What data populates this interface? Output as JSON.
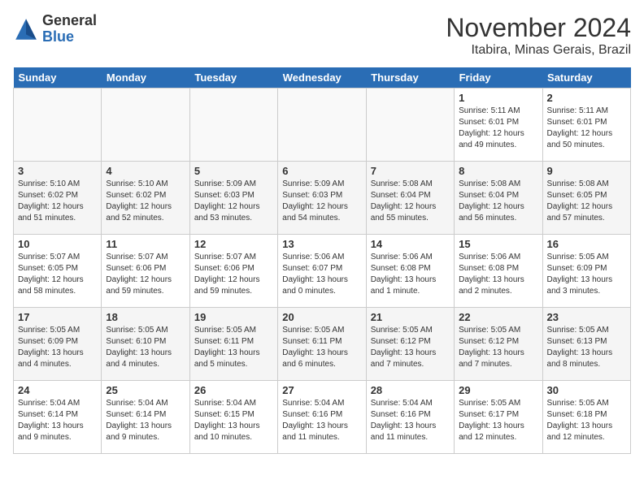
{
  "header": {
    "logo_general": "General",
    "logo_blue": "Blue",
    "month_title": "November 2024",
    "location": "Itabira, Minas Gerais, Brazil"
  },
  "days_of_week": [
    "Sunday",
    "Monday",
    "Tuesday",
    "Wednesday",
    "Thursday",
    "Friday",
    "Saturday"
  ],
  "weeks": [
    [
      {
        "day": "",
        "detail": ""
      },
      {
        "day": "",
        "detail": ""
      },
      {
        "day": "",
        "detail": ""
      },
      {
        "day": "",
        "detail": ""
      },
      {
        "day": "",
        "detail": ""
      },
      {
        "day": "1",
        "detail": "Sunrise: 5:11 AM\nSunset: 6:01 PM\nDaylight: 12 hours\nand 49 minutes."
      },
      {
        "day": "2",
        "detail": "Sunrise: 5:11 AM\nSunset: 6:01 PM\nDaylight: 12 hours\nand 50 minutes."
      }
    ],
    [
      {
        "day": "3",
        "detail": "Sunrise: 5:10 AM\nSunset: 6:02 PM\nDaylight: 12 hours\nand 51 minutes."
      },
      {
        "day": "4",
        "detail": "Sunrise: 5:10 AM\nSunset: 6:02 PM\nDaylight: 12 hours\nand 52 minutes."
      },
      {
        "day": "5",
        "detail": "Sunrise: 5:09 AM\nSunset: 6:03 PM\nDaylight: 12 hours\nand 53 minutes."
      },
      {
        "day": "6",
        "detail": "Sunrise: 5:09 AM\nSunset: 6:03 PM\nDaylight: 12 hours\nand 54 minutes."
      },
      {
        "day": "7",
        "detail": "Sunrise: 5:08 AM\nSunset: 6:04 PM\nDaylight: 12 hours\nand 55 minutes."
      },
      {
        "day": "8",
        "detail": "Sunrise: 5:08 AM\nSunset: 6:04 PM\nDaylight: 12 hours\nand 56 minutes."
      },
      {
        "day": "9",
        "detail": "Sunrise: 5:08 AM\nSunset: 6:05 PM\nDaylight: 12 hours\nand 57 minutes."
      }
    ],
    [
      {
        "day": "10",
        "detail": "Sunrise: 5:07 AM\nSunset: 6:05 PM\nDaylight: 12 hours\nand 58 minutes."
      },
      {
        "day": "11",
        "detail": "Sunrise: 5:07 AM\nSunset: 6:06 PM\nDaylight: 12 hours\nand 59 minutes."
      },
      {
        "day": "12",
        "detail": "Sunrise: 5:07 AM\nSunset: 6:06 PM\nDaylight: 12 hours\nand 59 minutes."
      },
      {
        "day": "13",
        "detail": "Sunrise: 5:06 AM\nSunset: 6:07 PM\nDaylight: 13 hours\nand 0 minutes."
      },
      {
        "day": "14",
        "detail": "Sunrise: 5:06 AM\nSunset: 6:08 PM\nDaylight: 13 hours\nand 1 minute."
      },
      {
        "day": "15",
        "detail": "Sunrise: 5:06 AM\nSunset: 6:08 PM\nDaylight: 13 hours\nand 2 minutes."
      },
      {
        "day": "16",
        "detail": "Sunrise: 5:05 AM\nSunset: 6:09 PM\nDaylight: 13 hours\nand 3 minutes."
      }
    ],
    [
      {
        "day": "17",
        "detail": "Sunrise: 5:05 AM\nSunset: 6:09 PM\nDaylight: 13 hours\nand 4 minutes."
      },
      {
        "day": "18",
        "detail": "Sunrise: 5:05 AM\nSunset: 6:10 PM\nDaylight: 13 hours\nand 4 minutes."
      },
      {
        "day": "19",
        "detail": "Sunrise: 5:05 AM\nSunset: 6:11 PM\nDaylight: 13 hours\nand 5 minutes."
      },
      {
        "day": "20",
        "detail": "Sunrise: 5:05 AM\nSunset: 6:11 PM\nDaylight: 13 hours\nand 6 minutes."
      },
      {
        "day": "21",
        "detail": "Sunrise: 5:05 AM\nSunset: 6:12 PM\nDaylight: 13 hours\nand 7 minutes."
      },
      {
        "day": "22",
        "detail": "Sunrise: 5:05 AM\nSunset: 6:12 PM\nDaylight: 13 hours\nand 7 minutes."
      },
      {
        "day": "23",
        "detail": "Sunrise: 5:05 AM\nSunset: 6:13 PM\nDaylight: 13 hours\nand 8 minutes."
      }
    ],
    [
      {
        "day": "24",
        "detail": "Sunrise: 5:04 AM\nSunset: 6:14 PM\nDaylight: 13 hours\nand 9 minutes."
      },
      {
        "day": "25",
        "detail": "Sunrise: 5:04 AM\nSunset: 6:14 PM\nDaylight: 13 hours\nand 9 minutes."
      },
      {
        "day": "26",
        "detail": "Sunrise: 5:04 AM\nSunset: 6:15 PM\nDaylight: 13 hours\nand 10 minutes."
      },
      {
        "day": "27",
        "detail": "Sunrise: 5:04 AM\nSunset: 6:16 PM\nDaylight: 13 hours\nand 11 minutes."
      },
      {
        "day": "28",
        "detail": "Sunrise: 5:04 AM\nSunset: 6:16 PM\nDaylight: 13 hours\nand 11 minutes."
      },
      {
        "day": "29",
        "detail": "Sunrise: 5:05 AM\nSunset: 6:17 PM\nDaylight: 13 hours\nand 12 minutes."
      },
      {
        "day": "30",
        "detail": "Sunrise: 5:05 AM\nSunset: 6:18 PM\nDaylight: 13 hours\nand 12 minutes."
      }
    ]
  ]
}
